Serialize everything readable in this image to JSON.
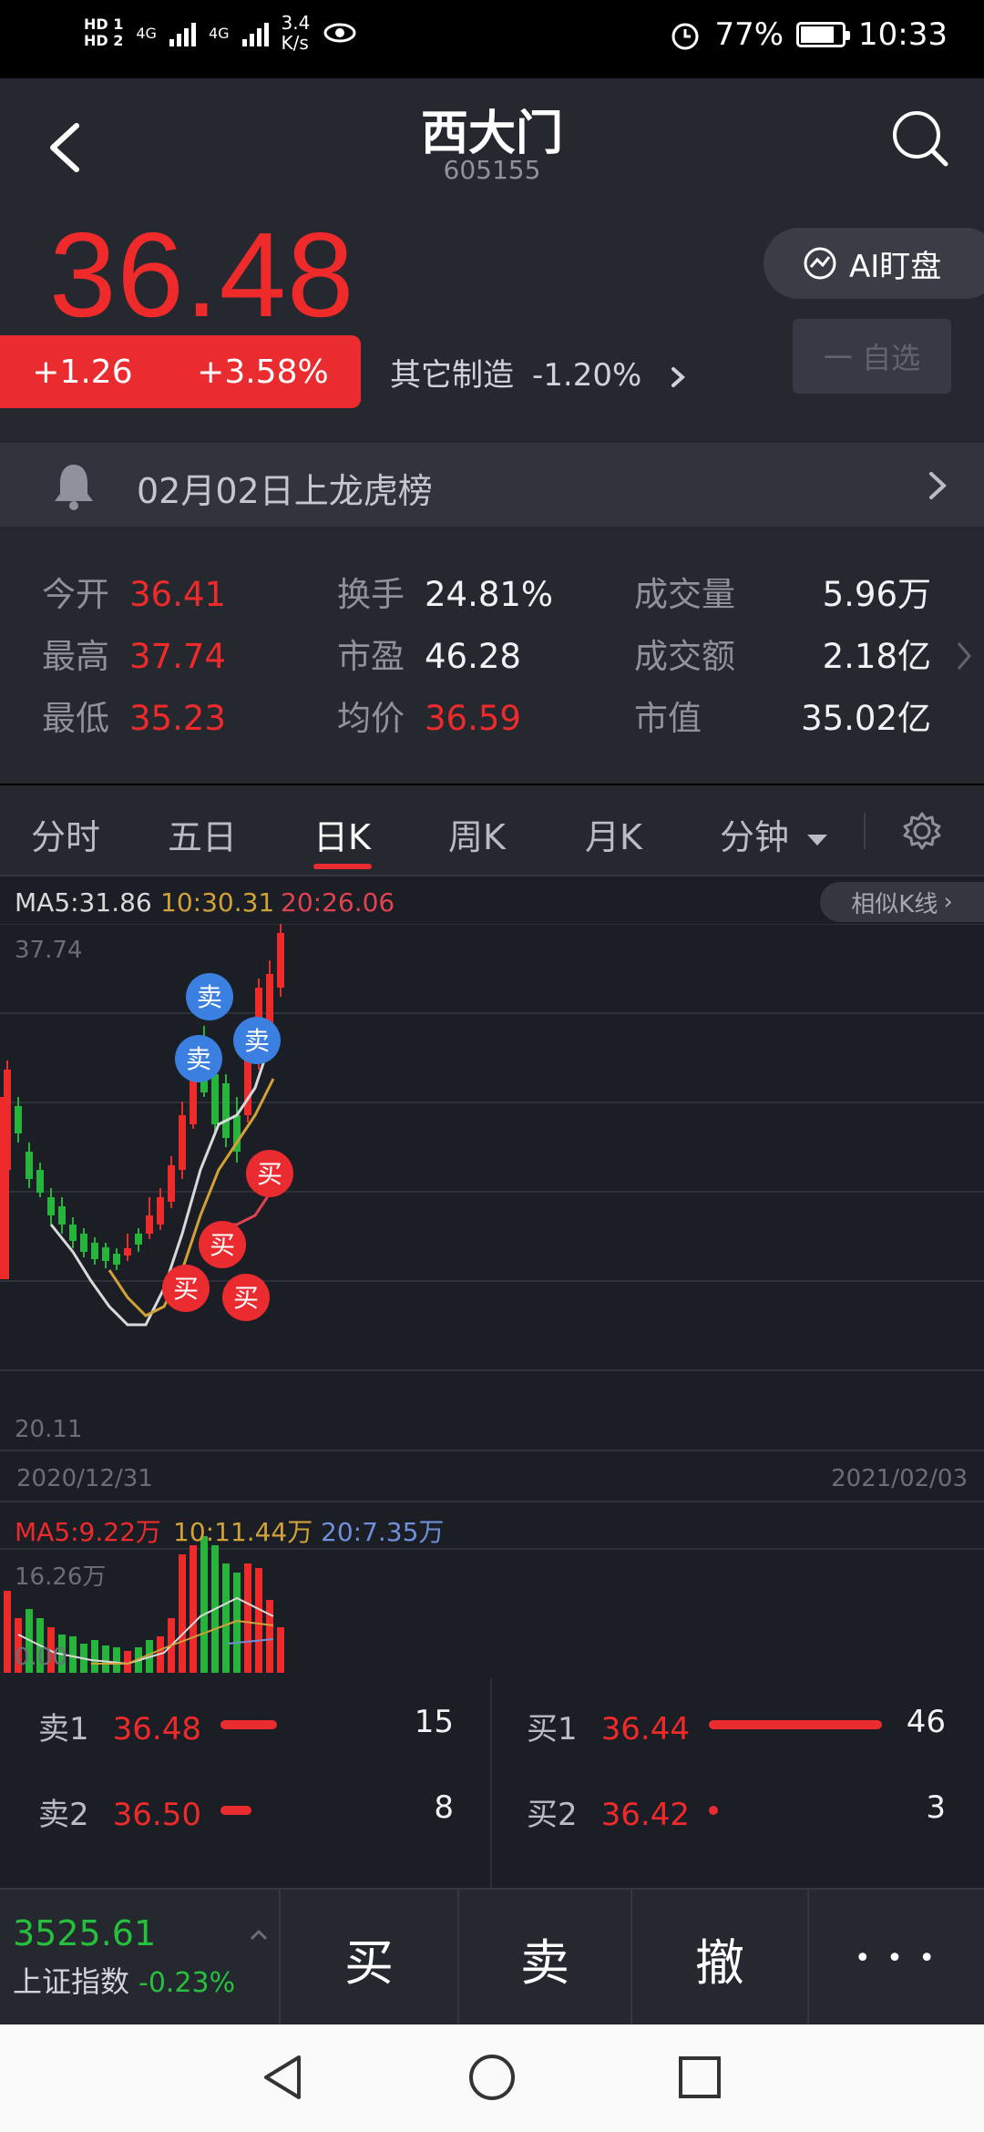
{
  "status": {
    "hd1": "HD 1",
    "hd2": "HD 2",
    "net1": "4G",
    "net2": "4G",
    "speed": "3.4\nK/s",
    "battery": "77%",
    "time": "10:33"
  },
  "header": {
    "title": "西大门",
    "code": "605155",
    "price": "36.48",
    "change": "+1.26",
    "change_pct": "+3.58%",
    "sector": "其它制造",
    "sector_pct": "-1.20%",
    "ai_label": "AI盯盘",
    "watch_label": "一 自选"
  },
  "alert": {
    "text": "02月02日上龙虎榜"
  },
  "stats": {
    "open_label": "今开",
    "open": "36.41",
    "high_label": "最高",
    "high": "37.74",
    "low_label": "最低",
    "low": "35.23",
    "turnover_label": "换手",
    "turnover": "24.81%",
    "pe_label": "市盈",
    "pe": "46.28",
    "avg_label": "均价",
    "avg": "36.59",
    "vol_label": "成交量",
    "vol": "5.96万",
    "amount_label": "成交额",
    "amount": "2.18亿",
    "cap_label": "市值",
    "cap": "35.02亿"
  },
  "tabs": [
    "分时",
    "五日",
    "日K",
    "周K",
    "月K",
    "分钟"
  ],
  "tab_active": "日K",
  "chart": {
    "ma5": "MA5:31.86",
    "ma10": "10:30.31",
    "ma20": "20:26.06",
    "similar": "相似K线",
    "y_max": "37.74",
    "y_min": "20.11",
    "date_start": "2020/12/31",
    "date_end": "2021/02/03",
    "vol_ma5": "MA5:9.22万",
    "vol_ma10": "10:11.44万",
    "vol_ma20": "20:7.35万",
    "vol_max": "16.26万",
    "vol_min": "0.00",
    "sell_label": "卖",
    "buy_label": "买",
    "colors": {
      "up": "#ee2a2a",
      "down": "#27b43c",
      "ma5": "#d9d9d9",
      "ma10": "#d1a238",
      "ma20": "#e0434f",
      "sell": "#3b7fe0",
      "buy": "#ea2b2f"
    }
  },
  "book": {
    "sell1_label": "卖1",
    "sell1_price": "36.48",
    "sell1_qty": "15",
    "sell2_label": "卖2",
    "sell2_price": "36.50",
    "sell2_qty": "8",
    "buy1_label": "买1",
    "buy1_price": "36.44",
    "buy1_qty": "46",
    "buy2_label": "买2",
    "buy2_price": "36.42",
    "buy2_qty": "3"
  },
  "trade": {
    "index_value": "3525.61",
    "index_name": "上证指数",
    "index_pct": "-0.23%",
    "buy": "买",
    "sell": "卖",
    "cancel": "撤",
    "more": "• • •"
  }
}
